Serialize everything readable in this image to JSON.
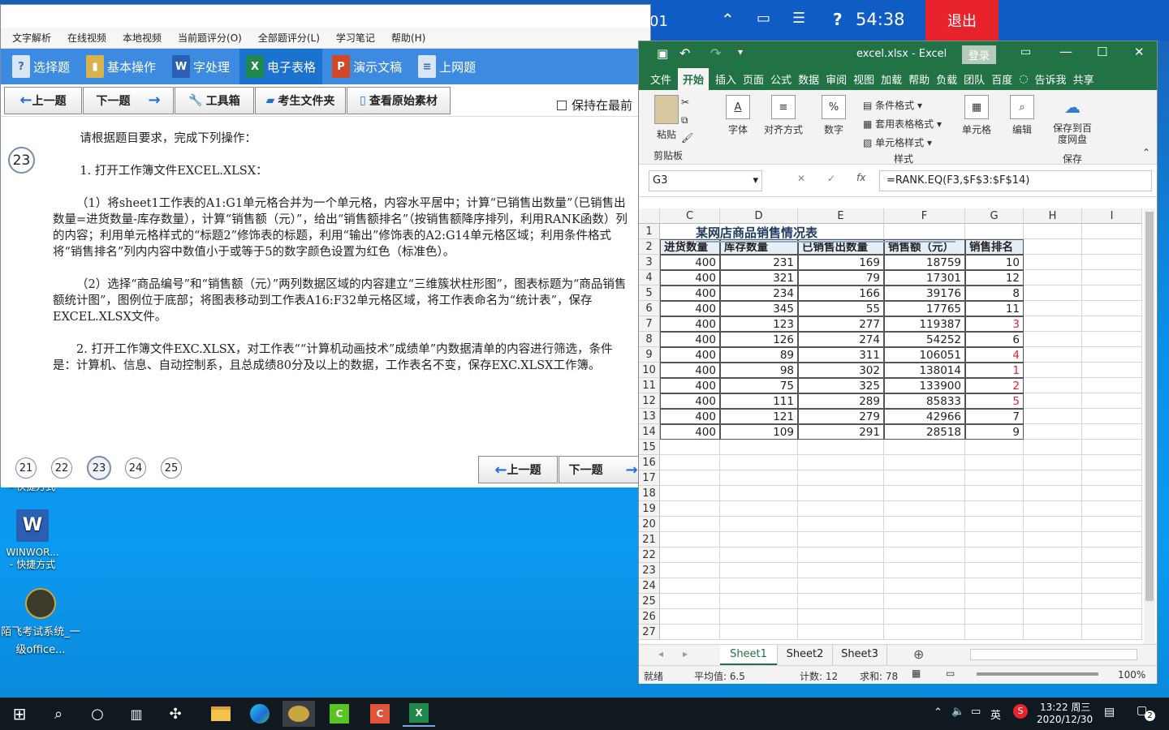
{
  "exam_bar": {
    "left_text": "01",
    "time": "54:38",
    "help": "?",
    "exit": "退出"
  },
  "exam_window": {
    "menu": [
      "文字解析",
      "在线视频",
      "本地视频",
      "当前题评分(O)",
      "全部题评分(L)",
      "学习笔记",
      "帮助(H)"
    ],
    "apps": [
      {
        "label": "选择题",
        "icon": "?",
        "color": "#d9e6f5"
      },
      {
        "label": "基本操作",
        "icon": "▮",
        "color": "#d8b24a"
      },
      {
        "label": "字处理",
        "icon": "W",
        "color": "#2b5fb4"
      },
      {
        "label": "电子表格",
        "icon": "X",
        "color": "#1f8a4c"
      },
      {
        "label": "演示文稿",
        "icon": "P",
        "color": "#d24726"
      },
      {
        "label": "上网题",
        "icon": "≡",
        "color": "#d9e6f5"
      }
    ],
    "tools": {
      "prev": "上一题",
      "next": "下一题",
      "toolbox": "工具箱",
      "folder": "考生文件夹",
      "material": "查看原始素材",
      "keep_on_top": "保持在最前"
    },
    "question_number": "23",
    "question": {
      "intro": "请根据题目要求，完成下列操作：",
      "p1": "1. 打开工作簿文件EXCEL.XLSX：",
      "p2": "（1）将sheet1工作表的A1:G1单元格合并为一个单元格，内容水平居中；计算“已销售出数量”（已销售出数量=进货数量-库存数量），计算“销售额（元）”，给出“销售额排名”（按销售额降序排列，利用RANK函数）列的内容；利用单元格样式的“标题2”修饰表的标题，利用“输出”修饰表的A2:G14单元格区域；利用条件格式将“销售排名”列内内容中数值小于或等于5的数字颜色设置为红色（标准色）。",
      "p3": "（2）选择“商品编号”和“销售额（元）”两列数据区域的内容建立“三维簇状柱形图”，图表标题为“商品销售额统计图”，图例位于底部；将图表移动到工作表A16:F32单元格区域，将工作表命名为“统计表”，保存EXCEL.XLSX文件。",
      "p4": "2. 打开工作簿文件EXC.XLSX，对工作表““计算机动画技术”成绩单”内数据清单的内容进行筛选，条件是：计算机、信息、自动控制系，且总成绩80分及以上的数据，工作表名不变，保存EXC.XLSX工作簿。"
    },
    "pages": [
      "21",
      "22",
      "23",
      "24",
      "25"
    ],
    "bottom_prev": "上一题",
    "bottom_next": "下一题"
  },
  "desktop": [
    {
      "label": "- 快捷方式",
      "sub": ""
    },
    {
      "label": "WINWOR...",
      "sub": "- 快捷方式"
    },
    {
      "label": "陌飞考试系统_一级office...",
      "sub": ""
    }
  ],
  "excel": {
    "title": "excel.xlsx - Excel",
    "login": "登录",
    "tabs": [
      "文件",
      "开始",
      "插入",
      "页面",
      "公式",
      "数据",
      "审阅",
      "视图",
      "加载",
      "帮助",
      "负载",
      "团队",
      "百度",
      "告诉我",
      "共享"
    ],
    "ribbon": {
      "paste": "粘贴",
      "clipboard": "剪贴板",
      "font": "字体",
      "align": "对齐方式",
      "number": "数字",
      "cond_format": "条件格式",
      "table_format": "套用表格格式",
      "cell_style": "单元格样式",
      "styles": "样式",
      "cells": "单元格",
      "edit": "编辑",
      "save_baidu": "保存到百度网盘",
      "save": "保存"
    },
    "name_box": "G3",
    "formula": "=RANK.EQ(F3,$F$3:$F$14)",
    "columns": [
      "C",
      "D",
      "E",
      "F",
      "G",
      "H",
      "I"
    ],
    "sheet_title": "某网店商品销售情况表",
    "headers": [
      "进货数量",
      "库存数量",
      "已销售出数量",
      "销售额（元）",
      "销售排名"
    ],
    "rows": [
      [
        400,
        231,
        169,
        18759,
        10
      ],
      [
        400,
        321,
        79,
        17301,
        12
      ],
      [
        400,
        234,
        166,
        39176,
        8
      ],
      [
        400,
        345,
        55,
        17765,
        11
      ],
      [
        400,
        123,
        277,
        119387,
        3
      ],
      [
        400,
        126,
        274,
        54252,
        6
      ],
      [
        400,
        89,
        311,
        106051,
        4
      ],
      [
        400,
        98,
        302,
        138014,
        1
      ],
      [
        400,
        75,
        325,
        133900,
        2
      ],
      [
        400,
        111,
        289,
        85833,
        5
      ],
      [
        400,
        121,
        279,
        42966,
        7
      ],
      [
        400,
        109,
        291,
        28518,
        9
      ]
    ],
    "row_numbers": [
      "1",
      "2",
      "3",
      "4",
      "5",
      "6",
      "7",
      "8",
      "9",
      "10",
      "11",
      "12",
      "13",
      "14",
      "15",
      "16",
      "17",
      "18",
      "19",
      "20",
      "21",
      "22",
      "23",
      "24",
      "25",
      "26",
      "27"
    ],
    "sheets": [
      "Sheet1",
      "Sheet2",
      "Sheet3"
    ],
    "status": {
      "ready": "就绪",
      "avg": "平均值: 6.5",
      "count": "计数: 12",
      "sum": "求和: 78",
      "zoom": "100%"
    },
    "red_color": "#e8232c"
  },
  "taskbar": {
    "time": "13:22 周三",
    "date": "2020/12/30",
    "ime": "英",
    "notif": "2"
  }
}
